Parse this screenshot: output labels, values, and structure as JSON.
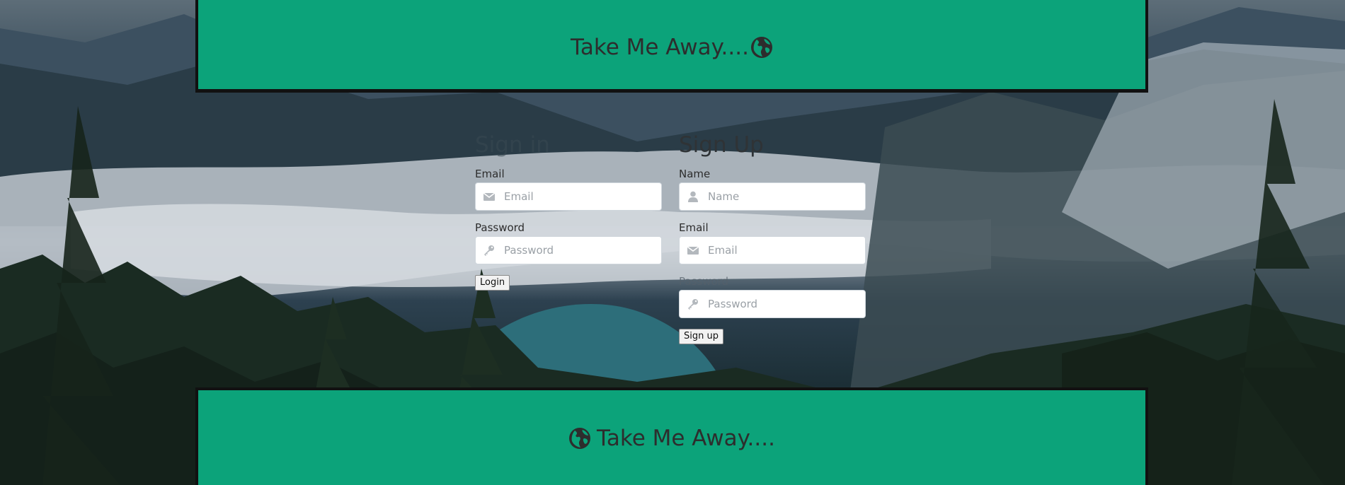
{
  "header": {
    "title": "Take Me Away....",
    "icon": "globe-icon"
  },
  "footer": {
    "title": "Take Me Away....",
    "icon": "globe-icon"
  },
  "signin": {
    "title": "Sign in",
    "email_label": "Email",
    "email_placeholder": "Email",
    "email_value": "",
    "password_label": "Password",
    "password_placeholder": "Password",
    "password_value": "",
    "button_label": "Login"
  },
  "signup": {
    "title": "Sign Up",
    "name_label": "Name",
    "name_placeholder": "Name",
    "name_value": "",
    "email_label": "Email",
    "email_placeholder": "Email",
    "email_value": "",
    "password_label": "Password",
    "password_placeholder": "Password",
    "password_value": "",
    "button_label": "Sign up"
  },
  "colors": {
    "banner_green": "#0ca37a",
    "text_dark": "#2d2d2d"
  }
}
